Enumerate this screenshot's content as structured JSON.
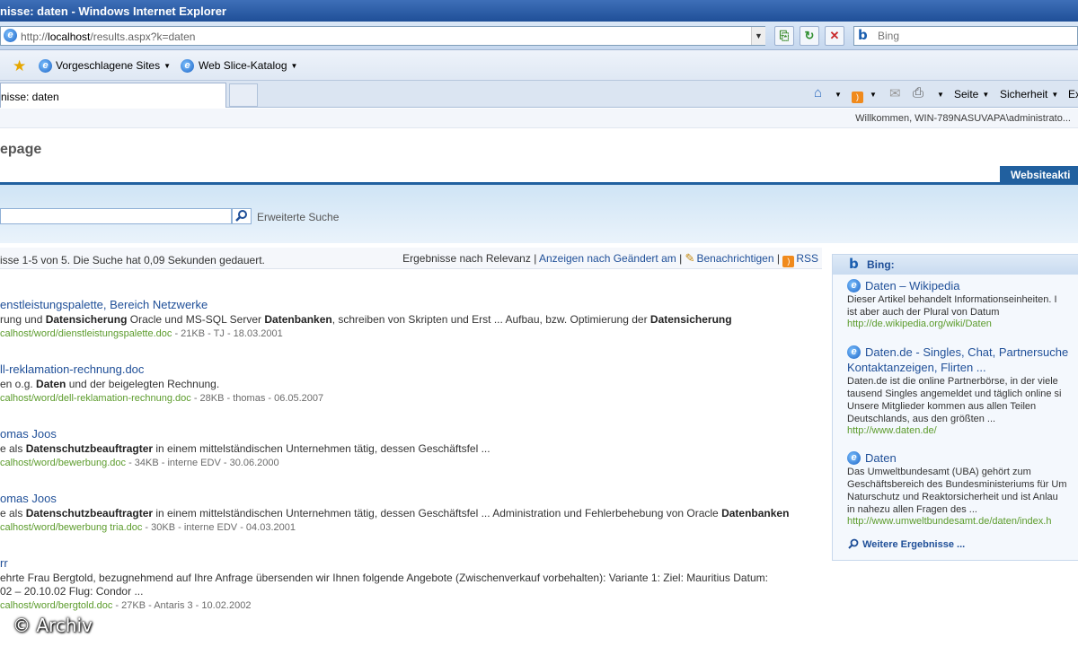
{
  "window": {
    "title": "nisse: daten - Windows Internet Explorer"
  },
  "address": {
    "prefix": "http://",
    "host": "localhost",
    "path": "/results.aspx?k=daten",
    "search_placeholder": "Bing"
  },
  "favorites": {
    "items": [
      {
        "label": "Vorgeschlagene Sites"
      },
      {
        "label": "Web Slice-Katalog"
      }
    ]
  },
  "tab": {
    "label": "nisse: daten"
  },
  "commands": {
    "page": "Seite",
    "security": "Sicherheit",
    "extra": "Ex"
  },
  "sharepoint": {
    "welcome": "Willkommen, WIN-789NASUVAPA\\administrato...",
    "site_title": "epage",
    "site_actions": "Websiteakti",
    "advanced_search": "Erweiterte Suche"
  },
  "results_header": {
    "count_text": "isse 1-5 von 5. Die Suche hat 0,09 Sekunden gedauert.",
    "sort_text": "Ergebnisse nach Relevanz",
    "sort_modified": "Anzeigen nach Geändert am",
    "alerts": "Benachrichtigen",
    "rss": "RSS"
  },
  "results": [
    {
      "title": "enstleistungspalette, Bereich Netzwerke",
      "snip_a": "rung und ",
      "b1": "Datensicherung",
      "snip_b": " Oracle und MS-SQL Server ",
      "b2": "Datenbanken",
      "snip_c": ", schreiben von Skripten und Erst ... Aufbau, bzw. Optimierung der ",
      "b3": "Datensicherung",
      "snip_d": "",
      "url": "calhost/word/dienstleistungspalette.doc",
      "meta": " - 21KB - TJ - 18.03.2001"
    },
    {
      "title": "ll-reklamation-rechnung.doc",
      "snip_a": "en o.g. ",
      "b1": "Daten",
      "snip_b": " und der beigelegten Rechnung.",
      "b2": "",
      "snip_c": "",
      "b3": "",
      "snip_d": "",
      "url": "calhost/word/dell-reklamation-rechnung.doc",
      "meta": " - 28KB - thomas - 06.05.2007"
    },
    {
      "title": "omas Joos",
      "snip_a": "e als ",
      "b1": "Datenschutzbeauftragter",
      "snip_b": " in einem mittelständischen Unternehmen tätig, dessen Geschäftsfel ...",
      "b2": "",
      "snip_c": "",
      "b3": "",
      "snip_d": "",
      "url": "calhost/word/bewerbung.doc",
      "meta": " - 34KB - interne EDV - 30.06.2000"
    },
    {
      "title": "omas Joos",
      "snip_a": "e als ",
      "b1": "Datenschutzbeauftragter",
      "snip_b": " in einem mittelständischen Unternehmen tätig, dessen Geschäftsfel ... Administration und Fehlerbehebung von Oracle ",
      "b2": "Datenbanken",
      "snip_c": "",
      "b3": "",
      "snip_d": "",
      "url": "calhost/word/bewerbung tria.doc",
      "meta": " - 30KB - interne EDV - 04.03.2001"
    },
    {
      "title": "rr",
      "snip_a": "ehrte Frau Bergtold, bezugnehmend auf Ihre Anfrage übersenden wir Ihnen folgende Angebote (Zwischenverkauf vorbehalten): Variante 1: Ziel: Mauritius Datum:",
      "b1": "",
      "snip_b": "",
      "b2": "",
      "snip_c": "",
      "b3": "",
      "snip_d": "02 – 20.10.02 Flug: Condor ...",
      "url": "calhost/word/bergtold.doc",
      "meta": " - 27KB - Antaris 3 - 10.02.2002"
    }
  ],
  "bing": {
    "heading": "Bing:",
    "items": [
      {
        "title": "Daten – Wikipedia",
        "title2": "",
        "desc": [
          "Dieser Artikel behandelt Informationseinheiten. I",
          "ist aber auch der Plural von Datum"
        ],
        "url": "http://de.wikipedia.org/wiki/Daten"
      },
      {
        "title": "Daten.de - Singles, Chat, Partnersuche",
        "title2": "Kontaktanzeigen, Flirten ...",
        "desc": [
          "Daten.de ist die online Partnerbörse, in der viele",
          "tausend Singles angemeldet und täglich online si",
          "Unsere Mitglieder kommen aus allen Teilen",
          "Deutschlands, aus den größten ..."
        ],
        "url": "http://www.daten.de/"
      },
      {
        "title": "Daten",
        "title2": "",
        "desc": [
          "Das Umweltbundesamt (UBA) gehört zum",
          "Geschäftsbereich des Bundesministeriums für Um",
          "Naturschutz und Reaktorsicherheit und ist Anlau",
          "in nahezu allen Fragen des ..."
        ],
        "url": "http://www.umweltbundesamt.de/daten/index.h"
      }
    ],
    "more": "Weitere Ergebnisse ..."
  },
  "watermark": "© Archiv"
}
